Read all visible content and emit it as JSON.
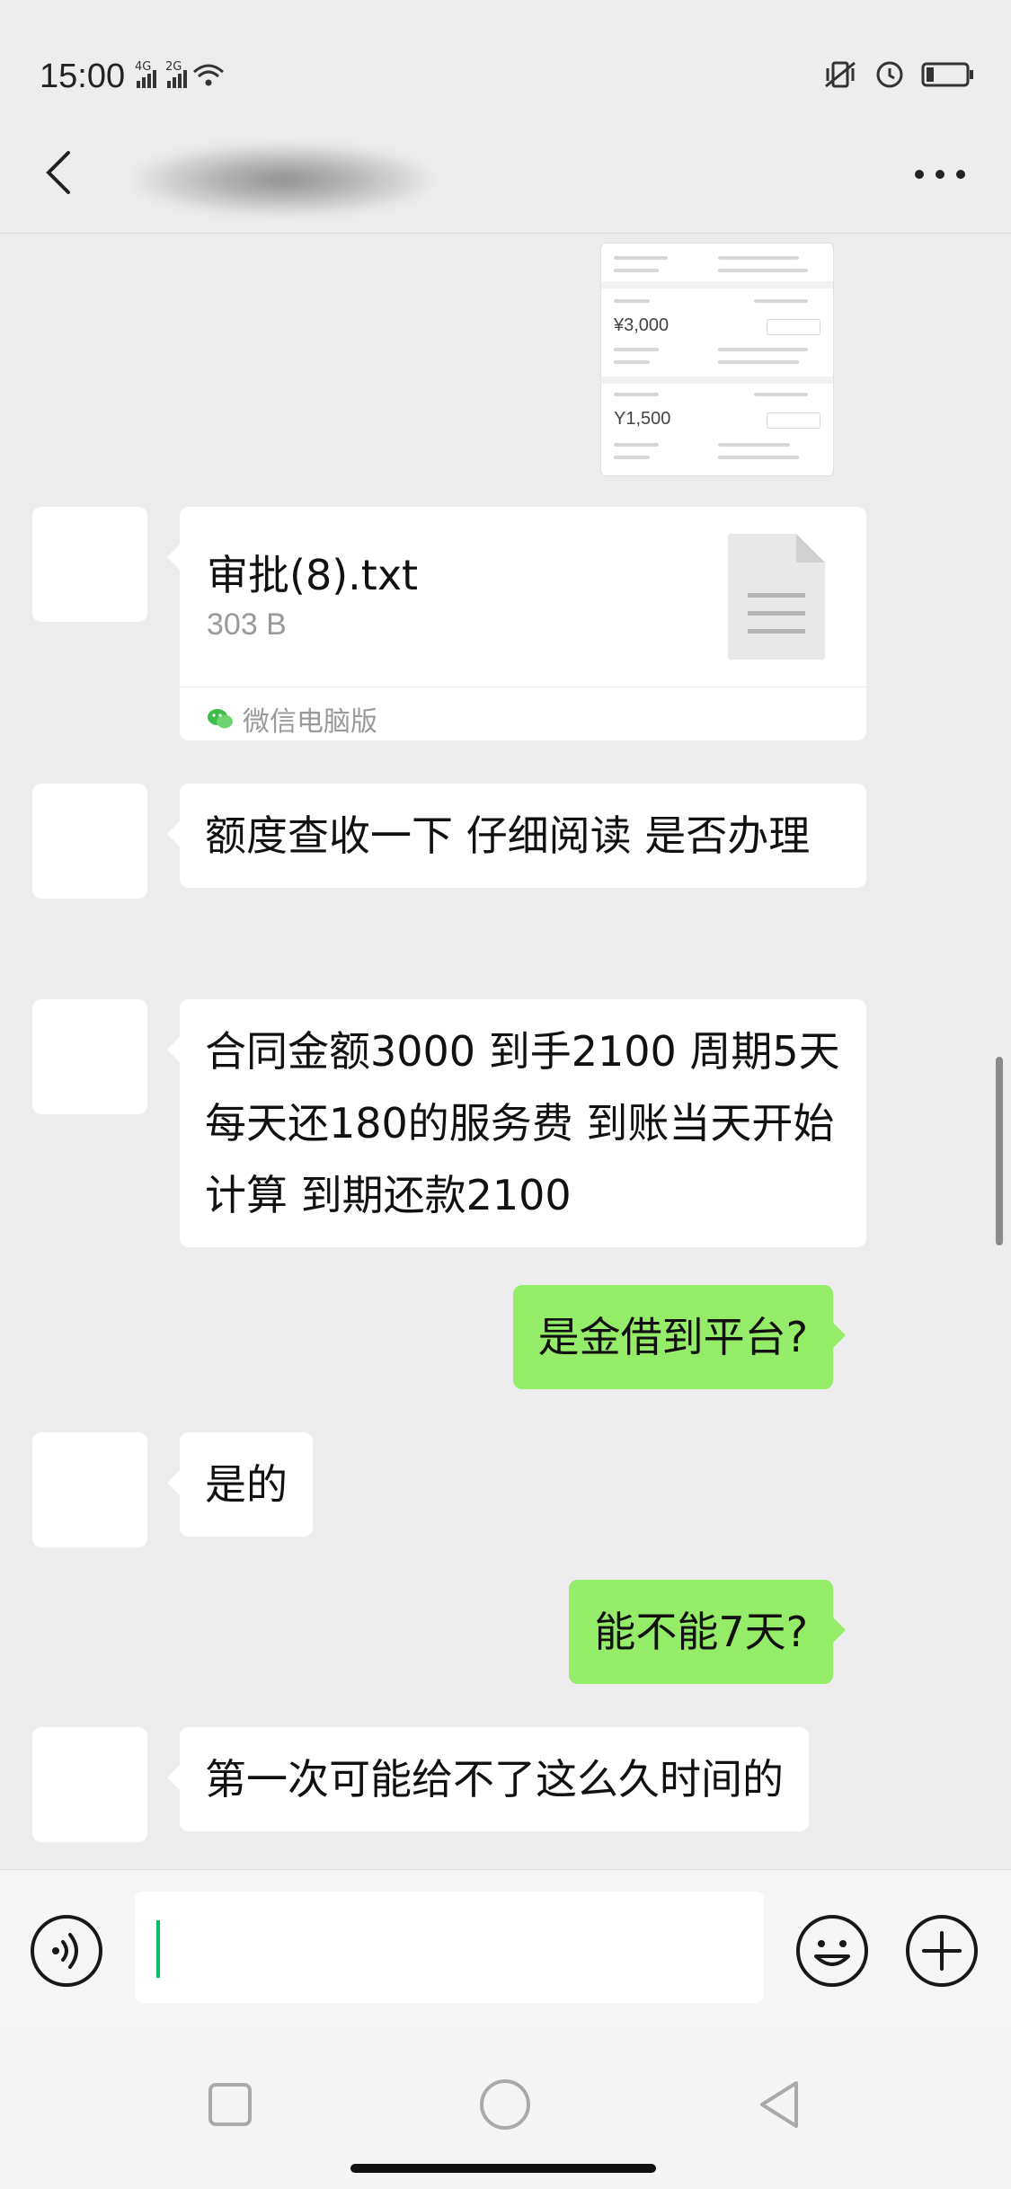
{
  "status_bar": {
    "time": "15:00",
    "network_1": "4G",
    "network_2": "2G"
  },
  "header": {
    "contact_name": "",
    "back_icon": "chevron-left-icon",
    "more_icon": "more-horizontal-icon"
  },
  "image_message": {
    "amount_1": "¥3,000",
    "amount_2": "Y1,500"
  },
  "file_message": {
    "name": "审批(8).txt",
    "size": "303 B",
    "source": "微信电脑版"
  },
  "messages": [
    {
      "side": "left",
      "text": "额度查收一下 仔细阅读 是否办理"
    },
    {
      "side": "left",
      "text": "合同金额3000  到手2100  周期5天  每天还180的服务费 到账当天开始计算 到期还款2100"
    },
    {
      "side": "right",
      "text": "是金借到平台?"
    },
    {
      "side": "left",
      "text": "是的"
    },
    {
      "side": "right",
      "text": "能不能7天?"
    },
    {
      "side": "left",
      "text": "第一次可能给不了这么久时间的"
    }
  ],
  "input_bar": {
    "input_value": "",
    "voice_icon": "voice-icon",
    "emoji_icon": "emoji-icon",
    "plus_icon": "plus-icon"
  },
  "colors": {
    "background": "#ededed",
    "sent_bubble": "#95ec69",
    "received_bubble": "#ffffff",
    "accent": "#07c160"
  }
}
